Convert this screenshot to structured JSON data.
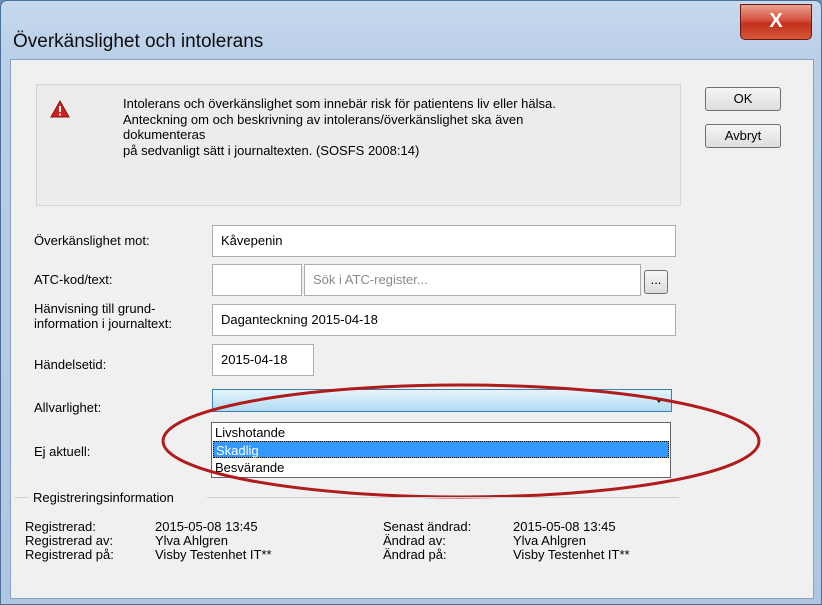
{
  "window": {
    "title": "Överkänslighet och intolerans",
    "close_glyph": "X"
  },
  "warning": {
    "icon": "warning-icon",
    "lines": [
      "Intolerans och överkänslighet som innebär risk för patientens liv eller hälsa.",
      "Anteckning om och beskrivning av intolerans/överkänslighet ska även",
      "dokumenteras",
      "på sedvanligt sätt i journaltexten. (SOSFS 2008:14)"
    ]
  },
  "buttons": {
    "ok": "OK",
    "cancel": "Avbryt",
    "browse": "..."
  },
  "form": {
    "overkanslighet_label": "Överkänslighet mot:",
    "overkanslighet_value": "Kåvepenin",
    "atc_label": "ATC-kod/text:",
    "atc_code_value": "",
    "atc_search_placeholder": "Sök i ATC-register...",
    "hanvisning_label_1": "Hänvisning till grund-",
    "hanvisning_label_2": "information i journaltext:",
    "hanvisning_value": "Daganteckning 2015-04-18",
    "handelsetid_label": "Händelsetid:",
    "handelsetid_value": "2015-04-18",
    "allvarlighet_label": "Allvarlighet:",
    "allvarlighet_value": "",
    "ej_aktuell_label": "Ej aktuell:",
    "allvarlighet_options": [
      "Livshotande",
      "Skadlig",
      "Besvärande"
    ],
    "allvarlighet_highlighted": "Skadlig"
  },
  "registration": {
    "group_title": "Registreringsinformation",
    "registrerad_label": "Registrerad:",
    "registrerad_value": "2015-05-08 13:45",
    "registrerad_av_label": "Registrerad av:",
    "registrerad_av_value": "Ylva Ahlgren",
    "registrerad_pa_label": "Registrerad på:",
    "registrerad_pa_value": "Visby Testenhet  IT**",
    "senast_andrad_label": "Senast ändrad:",
    "senast_andrad_value": "2015-05-08 13:45",
    "andrad_av_label": "Ändrad av:",
    "andrad_av_value": "Ylva Ahlgren",
    "andrad_pa_label": "Ändrad på:",
    "andrad_pa_value": "Visby Testenhet  IT**"
  },
  "colors": {
    "annotation_ellipse": "#b01c1c",
    "highlight": "#3399ff",
    "warning_icon": "#d41f1f"
  }
}
